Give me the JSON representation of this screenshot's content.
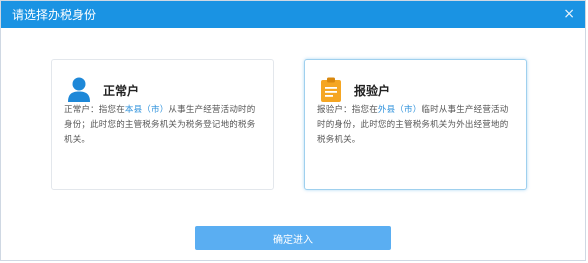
{
  "dialog": {
    "title": "请选择办税身份",
    "close_symbol": "×"
  },
  "cards": [
    {
      "title": "正常户",
      "icon": "user-icon",
      "desc_prefix": "正常户：指您在",
      "desc_link": "本县（市）",
      "desc_suffix": "从事生产经营活动时的身份；此时您的主管税务机关为税务登记地的税务机关。",
      "selected": false
    },
    {
      "title": "报验户",
      "icon": "clipboard-icon",
      "desc_prefix": "报验户：指您在",
      "desc_link": "外县（市）",
      "desc_suffix": "临时从事生产经营活动时的身份，此时您的主管税务机关为外出经营地的税务机关。",
      "selected": true
    }
  ],
  "confirm_label": "确定进入",
  "colors": {
    "title_bar": "#1a93e3",
    "accent_icon_user": "#1e88d8",
    "accent_icon_clipboard": "#f5a623",
    "button": "#5aaef2",
    "link": "#2a8fdb"
  }
}
